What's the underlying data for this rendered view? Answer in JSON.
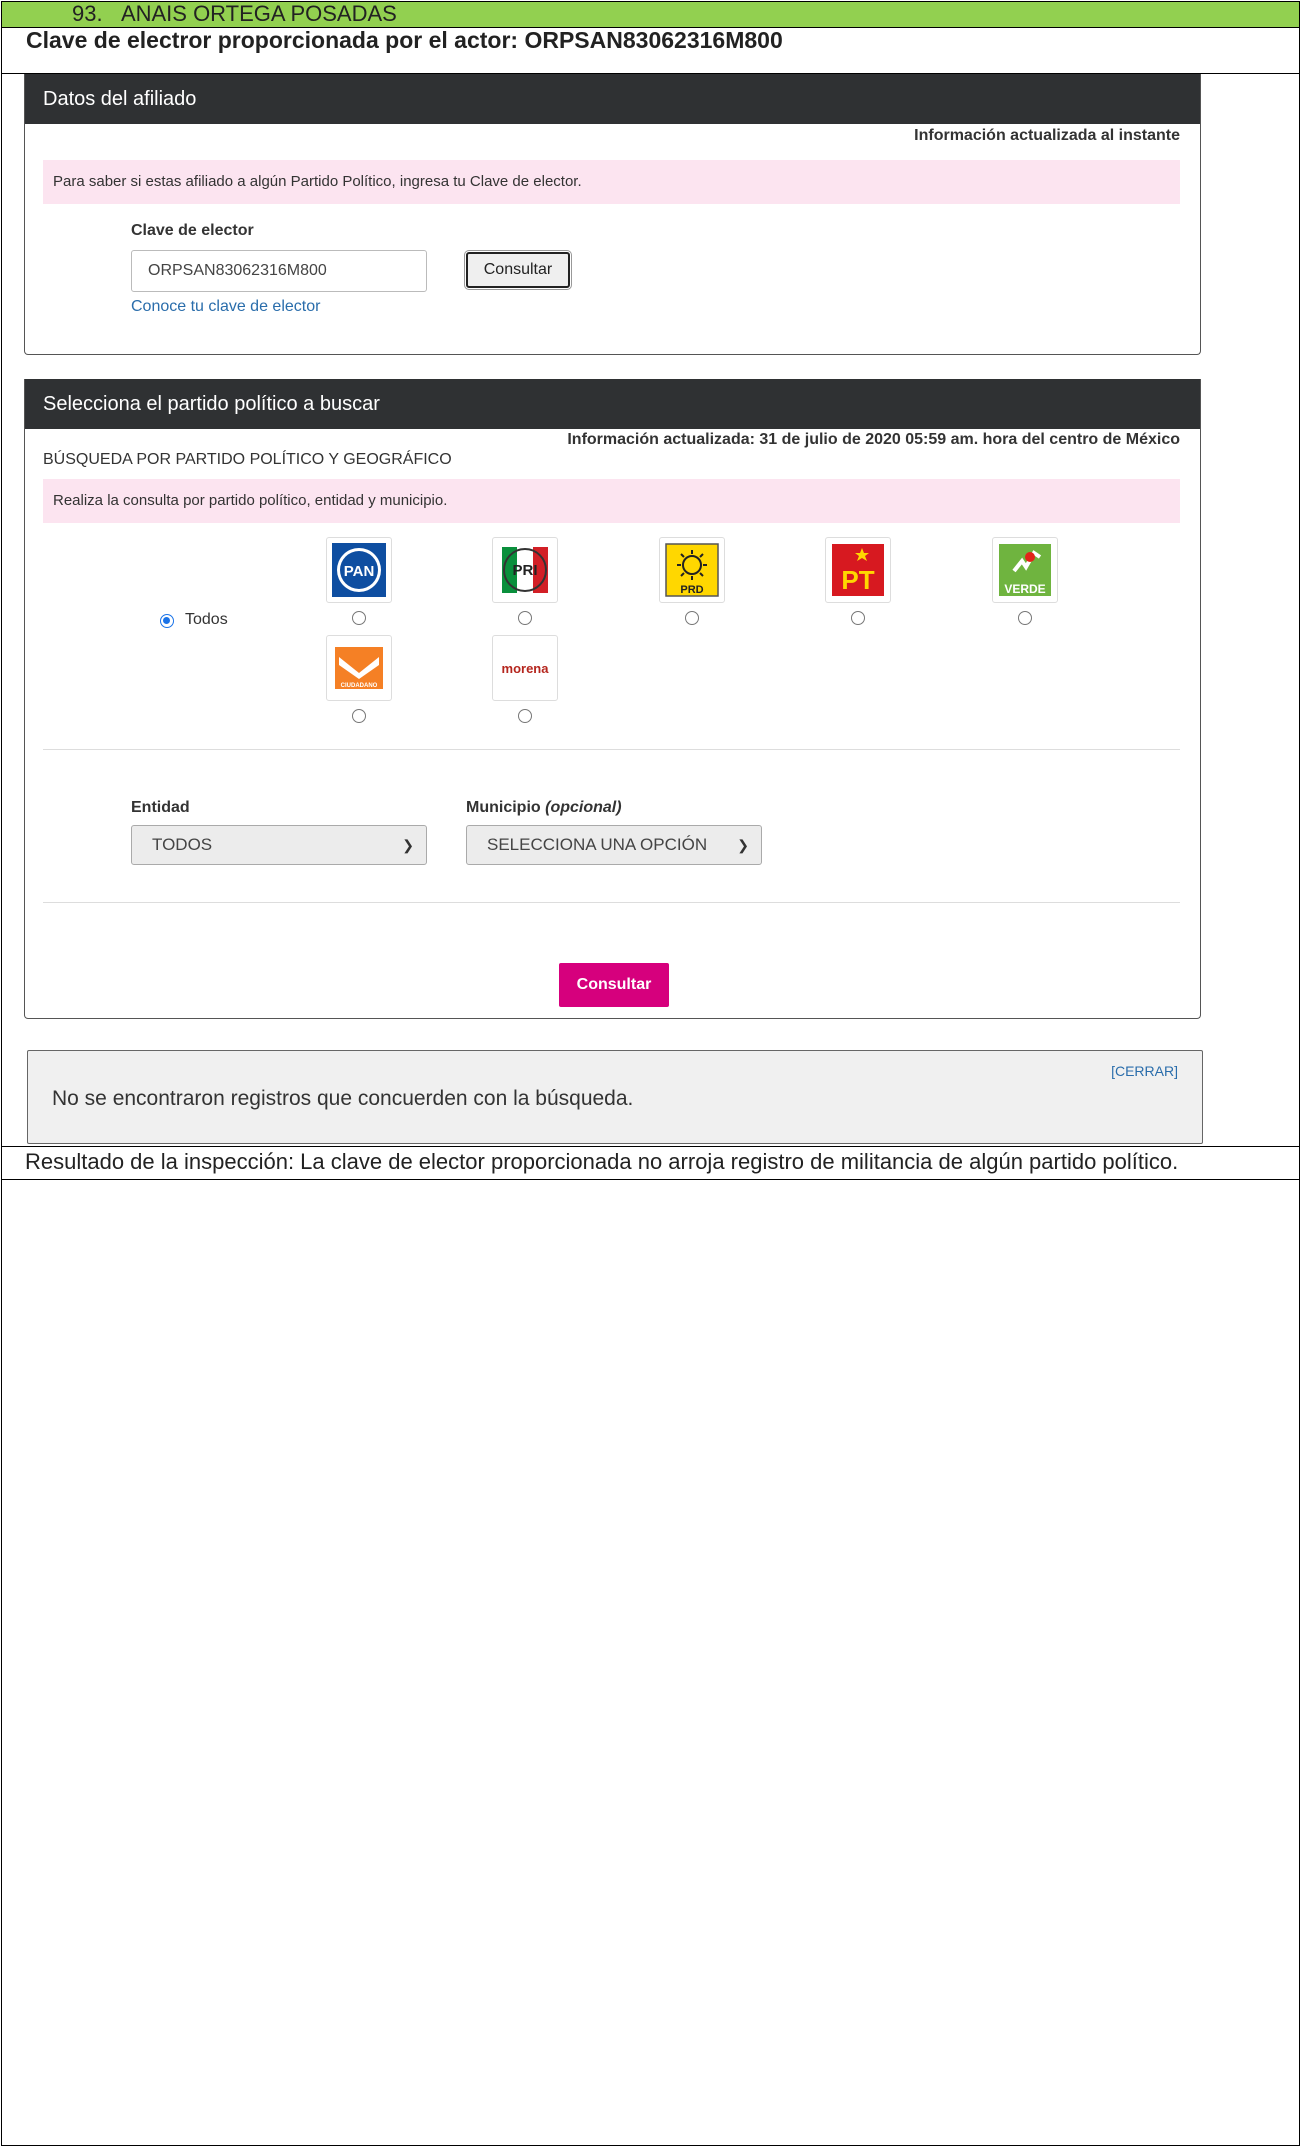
{
  "header": {
    "number": "93.",
    "name": "ANAIS ORTEGA POSADAS"
  },
  "clave_line": "Clave de electror proporcionada por el actor: ORPSAN83062316M800",
  "panel1": {
    "title": "Datos del afiliado",
    "update_info": "Información actualizada al instante",
    "notice": "Para saber si estas afiliado a algún Partido Político, ingresa tu Clave de elector.",
    "clave_label": "Clave de elector",
    "clave_value": "ORPSAN83062316M800",
    "consult_button": "Consultar",
    "link": "Conoce tu clave de elector"
  },
  "panel2": {
    "title": "Selecciona el partido político a buscar",
    "update_info": "Información actualizada: 31 de julio de 2020 05:59 am. hora del centro de México",
    "subtitle": "BÚSQUEDA POR PARTIDO POLÍTICO Y GEOGRÁFICO",
    "notice": "Realiza la consulta por partido político, entidad y municipio.",
    "todos_label": "Todos",
    "parties": [
      {
        "name": "PAN",
        "label": "PAN"
      },
      {
        "name": "PRI",
        "label": "PRI"
      },
      {
        "name": "PRD",
        "label": "PRD"
      },
      {
        "name": "PT",
        "label": "PT"
      },
      {
        "name": "VERDE",
        "label": "VERDE"
      },
      {
        "name": "MOVIMIENTO CIUDADANO",
        "label": "CIUDADANO"
      },
      {
        "name": "morena",
        "label": "morena"
      }
    ],
    "entidad_label": "Entidad",
    "entidad_value": "TODOS",
    "municipio_label": "Municipio",
    "municipio_optional": "(opcional)",
    "municipio_value": "SELECCIONA UNA OPCIÓN",
    "consult_button": "Consultar"
  },
  "result_notice": {
    "close": "[CERRAR]",
    "message": "No se encontraron registros que concuerden con la búsqueda."
  },
  "result_line": "Resultado de la inspección: La clave de elector proporcionada no arroja registro de militancia de algún partido político."
}
